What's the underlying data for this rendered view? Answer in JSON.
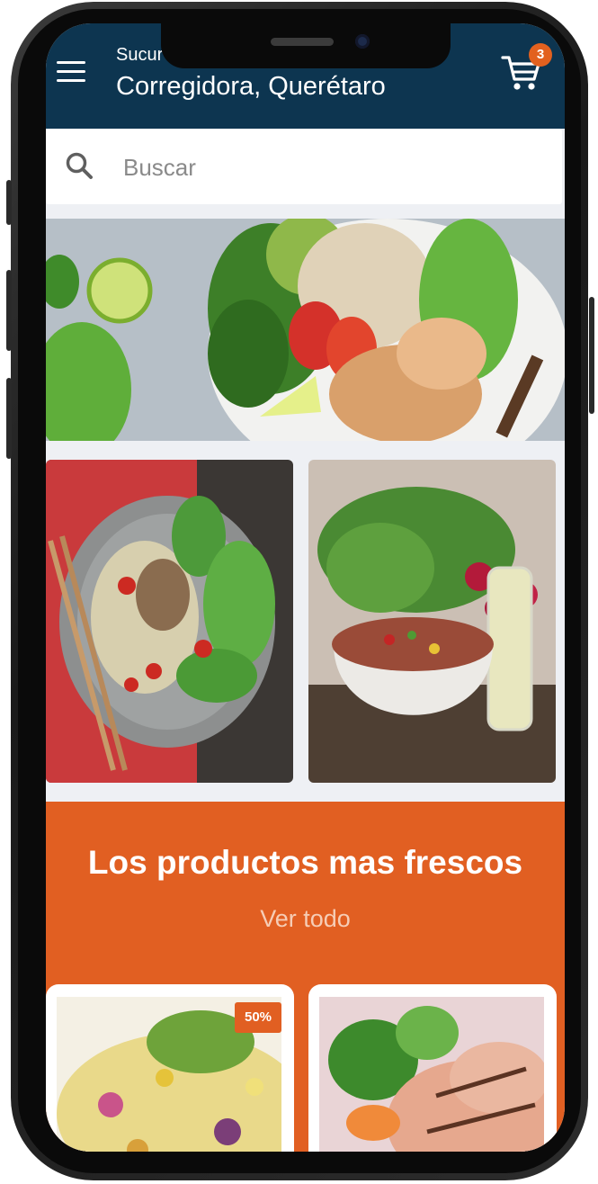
{
  "header": {
    "branch_label": "Sucur",
    "branch_name": "Corregidora, Querétaro",
    "cart_count": "3"
  },
  "search": {
    "placeholder": "Buscar"
  },
  "promo": {
    "title": "Los productos mas frescos",
    "view_all": "Ver todo"
  },
  "products": [
    {
      "discount": "50%"
    },
    {}
  ],
  "colors": {
    "header_bg": "#0d3550",
    "accent": "#e15f22"
  },
  "icons": [
    "menu-icon",
    "cart-icon",
    "search-icon"
  ]
}
